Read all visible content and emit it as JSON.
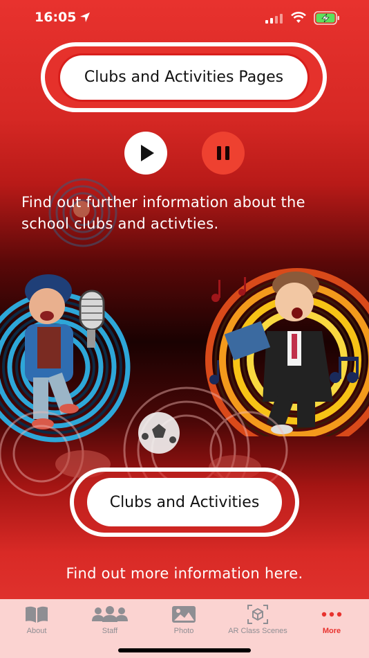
{
  "status_bar": {
    "time": "16:05"
  },
  "header_button": {
    "label": "Clubs and Activities Pages"
  },
  "audio": {
    "play_icon": "play-icon",
    "pause_icon": "pause-icon"
  },
  "intro_text": "Find out further information about the school clubs and activties.",
  "main_button": {
    "label": "Clubs and Activities"
  },
  "footer_text": "Find out more information here.",
  "tabs": [
    {
      "label": "About",
      "icon": "book-icon",
      "active": false
    },
    {
      "label": "Staff",
      "icon": "people-icon",
      "active": false
    },
    {
      "label": "Photo",
      "icon": "photo-icon",
      "active": false
    },
    {
      "label": "AR Class Scenes",
      "icon": "ar-scan-icon",
      "active": false
    },
    {
      "label": "More",
      "icon": "more-icon",
      "active": true
    }
  ],
  "colors": {
    "accent": "#e8322e",
    "tab_bg": "#fbd3d1",
    "inactive": "#8e8e93"
  }
}
